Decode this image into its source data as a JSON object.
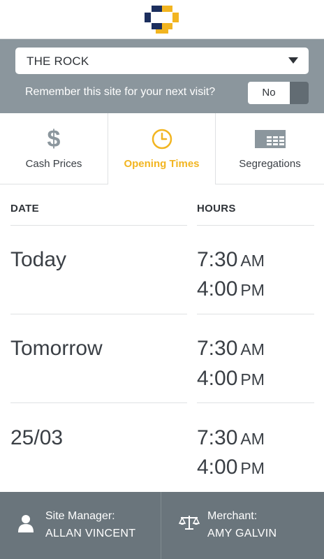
{
  "site_selector": {
    "selected_site": "THE ROCK",
    "remember_label": "Remember this site for your next visit?",
    "remember_toggle_value": "No"
  },
  "tabs": [
    {
      "label": "Cash Prices",
      "icon": "dollar-icon",
      "active": false
    },
    {
      "label": "Opening Times",
      "icon": "clock-icon",
      "active": true
    },
    {
      "label": "Segregations",
      "icon": "table-grid-icon",
      "active": false
    }
  ],
  "colors": {
    "accent": "#f2b521",
    "brand_navy": "#1c2f5e",
    "panel_grey": "#8b969d",
    "footer_grey": "#6a757c"
  },
  "opening_times": {
    "date_header": "DATE",
    "hours_header": "HOURS",
    "rows": [
      {
        "date": "Today",
        "open_time": "7:30",
        "open_ampm": "AM",
        "close_time": "4:00",
        "close_ampm": "PM"
      },
      {
        "date": "Tomorrow",
        "open_time": "7:30",
        "open_ampm": "AM",
        "close_time": "4:00",
        "close_ampm": "PM"
      },
      {
        "date": "25/03",
        "open_time": "7:30",
        "open_ampm": "AM",
        "close_time": "4:00",
        "close_ampm": "PM"
      }
    ]
  },
  "footer": {
    "site_manager_label": "Site Manager:",
    "site_manager_name": "ALLAN VINCENT",
    "merchant_label": "Merchant:",
    "merchant_name": "AMY GALVIN"
  }
}
